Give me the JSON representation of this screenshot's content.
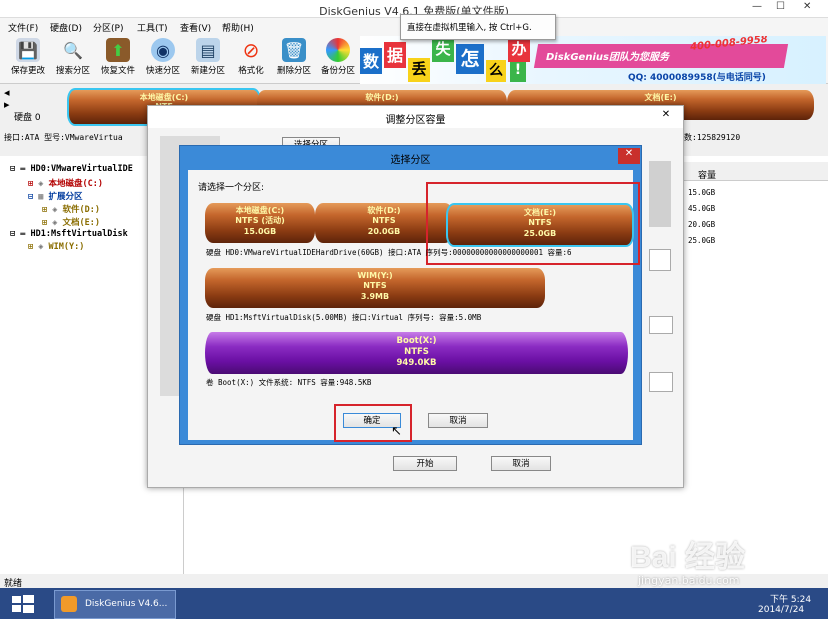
{
  "app": {
    "title": "DiskGenius V4.6.1 免费版(单文件版)"
  },
  "tooltip": {
    "text": "直接在虚拟机里输入, 按 Ctrl+G."
  },
  "menus": [
    "文件(F)",
    "硬盘(D)",
    "分区(P)",
    "工具(T)",
    "查看(V)",
    "帮助(H)"
  ],
  "toolbar": [
    "保存更改",
    "搜索分区",
    "恢复文件",
    "快速分区",
    "新建分区",
    "格式化",
    "删除分区",
    "备份分区"
  ],
  "banner": {
    "chars": [
      "数",
      "据",
      "丢",
      "失",
      "怎",
      "么",
      "办",
      "!"
    ],
    "phone1": "400-008-9958",
    "team": "DiskGenius团队为您服务",
    "qq": "QQ: 4000089958(与电话同号)"
  },
  "diskbar": {
    "disk_label": "硬盘 0",
    "iface": "接口:ATA  型号:VMwareVirtua",
    "sectors": "数:125829120",
    "parts": [
      {
        "name": "本地磁盘(C:)",
        "fs": "NTF",
        "size": "15."
      },
      {
        "name": "软件(D:)"
      },
      {
        "name": "文档(E:)"
      }
    ]
  },
  "tree": [
    {
      "text": "HD0:VMwareVirtualIDE"
    },
    {
      "text": "本地磁盘(C:)"
    },
    {
      "text": "扩展分区"
    },
    {
      "text": "软件(D:)"
    },
    {
      "text": "文档(E:)"
    },
    {
      "text": "HD1:MsftVirtualDisk"
    },
    {
      "text": "WIM(Y:)"
    }
  ],
  "right_table": {
    "header": "容量",
    "rows": [
      "15.0GB",
      "45.0GB",
      "20.0GB",
      "25.0GB"
    ]
  },
  "statusbar": {
    "text": "就绪"
  },
  "taskbar": {
    "app": "DiskGenius V4.6...",
    "time": "下午 5:24",
    "date": "2014/7/24"
  },
  "watermark": {
    "brand": "Bai 经验",
    "url": "jingyan.baidu.com"
  },
  "outer_dialog": {
    "title": "调整分区容量",
    "tab": "选择分区",
    "start_button": "开始",
    "cancel_button": "取消"
  },
  "inner_dialog": {
    "title": "选择分区",
    "prompt": "请选择一个分区:",
    "disk0": {
      "parts": [
        {
          "name": "本地磁盘(C:)",
          "fs": "NTFS (活动)",
          "size": "15.0GB"
        },
        {
          "name": "软件(D:)",
          "fs": "NTFS",
          "size": "20.0GB"
        },
        {
          "name": "文档(E:)",
          "fs": "NTFS",
          "size": "25.0GB"
        }
      ],
      "info": "硬盘 HD0:VMwareVirtualIDEHardDrive(60GB)   接口:ATA  序列号:00000000000000000001  容量:6"
    },
    "disk1": {
      "part": {
        "name": "WIM(Y:)",
        "fs": "NTFS",
        "size": "3.9MB"
      },
      "info": "硬盘 HD1:MsftVirtualDisk(5.00MB)   接口:Virtual   序列号:   容量:5.0MB"
    },
    "volume": {
      "part": {
        "name": "Boot(X:)",
        "fs": "NTFS",
        "size": "949.0KB"
      },
      "info": "卷 Boot(X:)   文件系统: NTFS  容量:948.5KB"
    },
    "ok_button": "确定",
    "cancel_button": "取消"
  }
}
